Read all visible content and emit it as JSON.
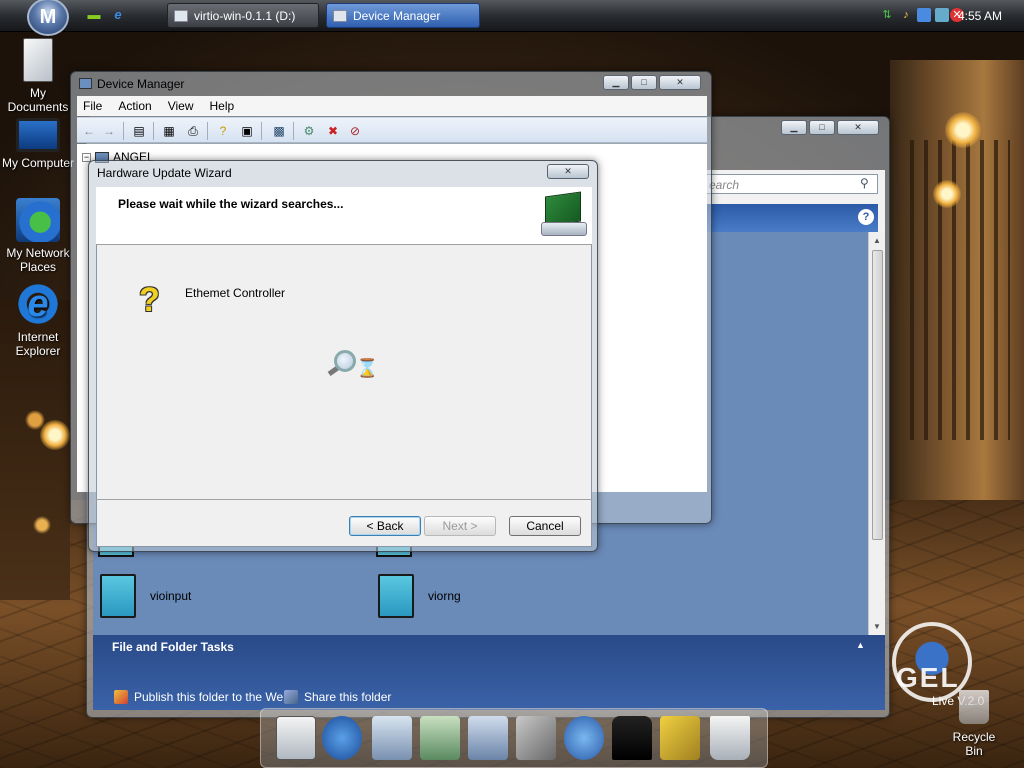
{
  "taskbar": {
    "start_label": "M",
    "tasks": [
      {
        "label": "virtio-win-0.1.1 (D:)",
        "active": false
      },
      {
        "label": "Device Manager",
        "active": true
      }
    ],
    "clock": "4:55 AM"
  },
  "desktop": {
    "icons": [
      {
        "label": "My Documents",
        "icon": "my-documents-icon"
      },
      {
        "label": "My Computer",
        "icon": "my-computer-icon"
      },
      {
        "label": "My Network Places",
        "icon": "network-places-icon"
      },
      {
        "label": "Internet Explorer",
        "icon": "internet-explorer-icon"
      }
    ],
    "recycle_bin": "Recycle Bin",
    "brand_text": "GEL",
    "brand_version": "Live V.2.0"
  },
  "explorer": {
    "search_placeholder": "earch",
    "files": [
      {
        "name": "vioinput"
      },
      {
        "name": "viorng"
      }
    ],
    "tasks_title": "File and Folder Tasks",
    "task_links": [
      "Publish this folder to the Web",
      "Share this folder"
    ]
  },
  "device_manager": {
    "title": "Device Manager",
    "menu": [
      "File",
      "Action",
      "View",
      "Help"
    ],
    "tree_root": "ANGEL"
  },
  "wizard": {
    "title": "Hardware Update Wizard",
    "heading": "Please wait while the wizard searches...",
    "device_name": "Ethemet Controller",
    "buttons": {
      "back": "< Back",
      "next": "Next >",
      "cancel": "Cancel"
    }
  },
  "colors": {
    "accent_blue": "#2c5aa6",
    "taskbar_active": "#2f5fb0"
  }
}
